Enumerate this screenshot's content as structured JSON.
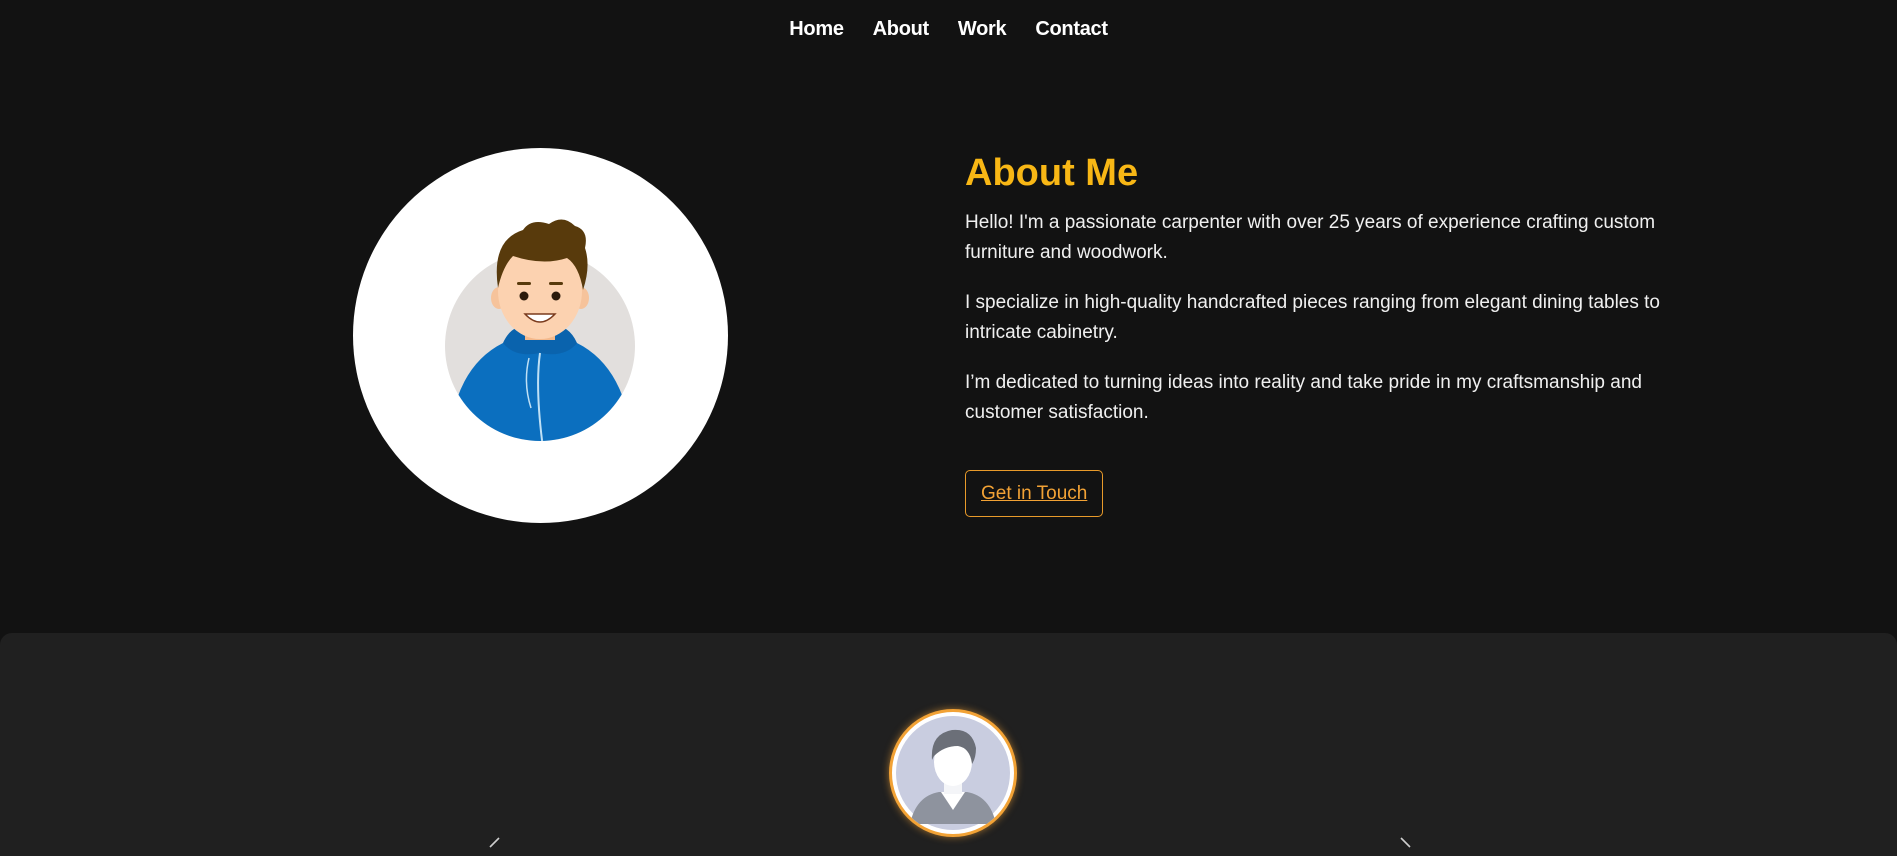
{
  "nav": {
    "items": [
      {
        "label": "Home"
      },
      {
        "label": "About"
      },
      {
        "label": "Work"
      },
      {
        "label": "Contact"
      }
    ]
  },
  "about": {
    "title": "About Me",
    "paragraphs": [
      "Hello! I'm a passionate carpenter with over 25 years of experience crafting custom furniture and woodwork.",
      "I specialize in high-quality handcrafted pieces ranging from elegant dining tables to intricate cabinetry.",
      "I’m dedicated to turning ideas into reality and take pride in my craftsmanship and customer satisfaction."
    ],
    "cta_label": "Get in Touch"
  },
  "icons": {
    "hero_avatar": "cartoon-person-avatar-icon",
    "testimonial_avatar": "person-silhouette-avatar-icon",
    "prev": "chevron-left-icon",
    "next": "chevron-right-icon"
  },
  "colors": {
    "background": "#121212",
    "panel": "#202020",
    "accent_title": "#f8b715",
    "accent_button": "#f2a235",
    "hoodie": "#0b6fbf"
  }
}
